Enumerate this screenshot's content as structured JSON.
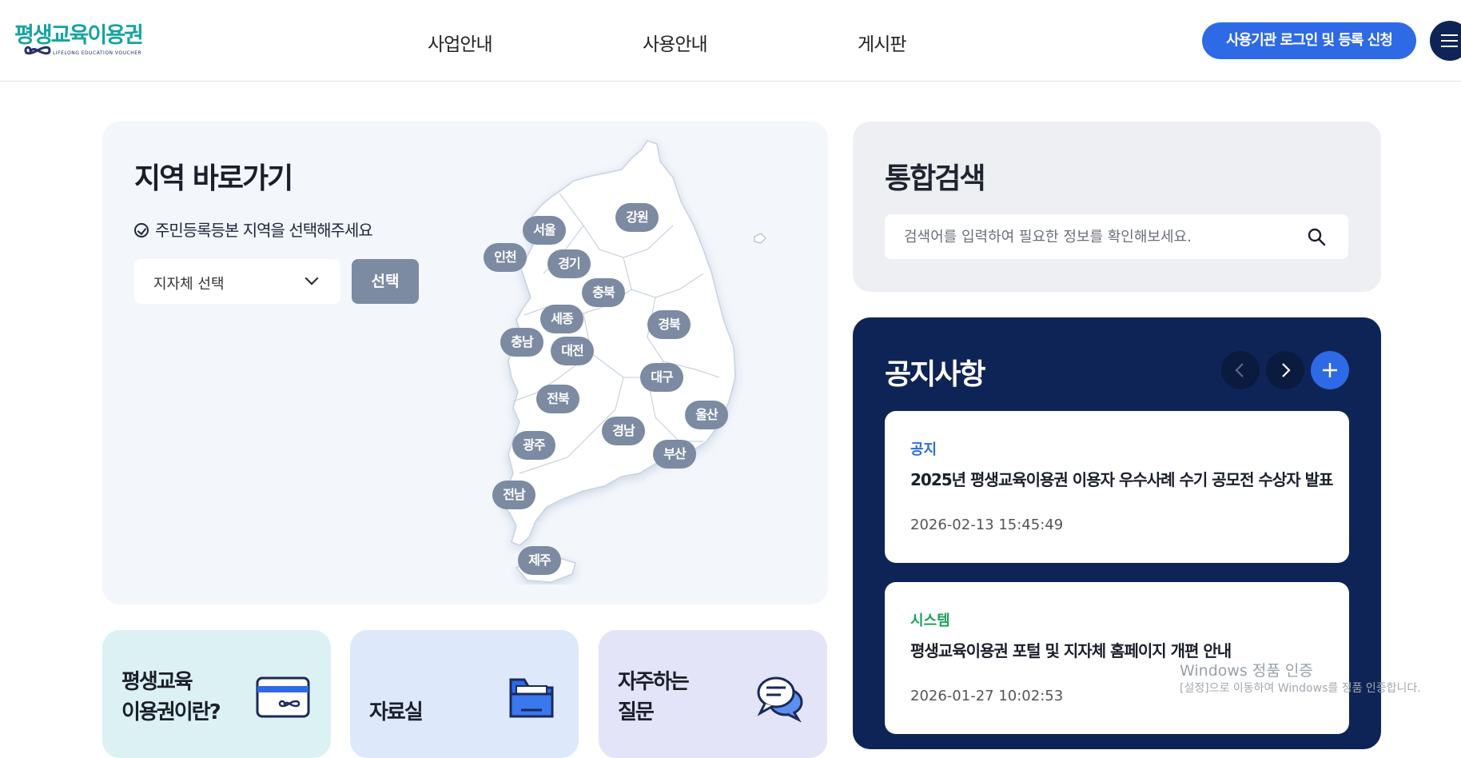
{
  "header": {
    "logo_text_a": "평생교육",
    "logo_text_b": "이용권",
    "logo_sub": "LIFELONG EDUCATION VOUCHER",
    "nav": [
      "사업안내",
      "사용안내",
      "게시판"
    ],
    "login_label": "사용기관 로그인 및 등록 신청"
  },
  "region": {
    "title": "지역 바로가기",
    "subtitle": "주민등록등본 지역을 선택해주세요",
    "select_value": "지자체 선택",
    "select_button": "선택",
    "regions": [
      "서울",
      "강원",
      "인천",
      "경기",
      "충북",
      "세종",
      "경북",
      "충남",
      "대전",
      "대구",
      "전북",
      "울산",
      "경남",
      "광주",
      "부산",
      "전남",
      "제주"
    ]
  },
  "search": {
    "title": "통합검색",
    "placeholder": "검색어를 입력하여 필요한 정보를 확인해보세요."
  },
  "notice": {
    "title": "공지사항",
    "items": [
      {
        "category": "공지",
        "category_color": "#2e6ae6",
        "title": "2025년 평생교육이용권 이용자 우수사례 수기 공모전 수상자 발표",
        "date": "2026-02-13 15:45:49"
      },
      {
        "category": "시스템",
        "category_color": "#1f9e5c",
        "title": "평생교육이용권 포털 및 지자체 홈페이지 개편 안내",
        "date": "2026-01-27 10:02:53"
      }
    ]
  },
  "tiles": [
    {
      "line1": "평생교육",
      "line2": "이용권이란?",
      "icon": "card-icon",
      "bg": "#dcf1f4"
    },
    {
      "line1": "",
      "line2": "자료실",
      "icon": "folder-icon",
      "bg": "#dde9fb"
    },
    {
      "line1": "자주하는",
      "line2": "질문",
      "icon": "chat-bubble-icon",
      "bg": "#e3e4f8"
    }
  ],
  "os_watermark": {
    "line1": "Windows 정품 인증",
    "line2": "[설정]으로 이동하여 Windows를 정품 인증합니다."
  }
}
